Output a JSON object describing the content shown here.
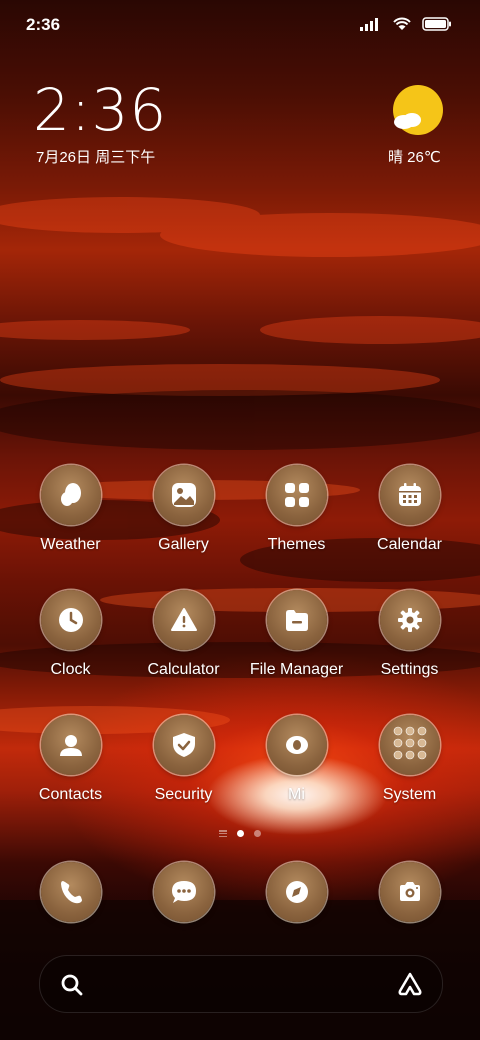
{
  "status_bar": {
    "time": "2:36",
    "signal_icon": "signal-bars-icon",
    "wifi_icon": "wifi-icon",
    "battery_icon": "battery-full-icon"
  },
  "clock_widget": {
    "time": "2:36",
    "date": "7月26日 周三下午"
  },
  "weather_widget": {
    "icon": "sun-cloud-icon",
    "summary": "晴 26℃",
    "sun_color": "#f5c518"
  },
  "apps": [
    {
      "label": "Weather",
      "icon": "weather-icon"
    },
    {
      "label": "Gallery",
      "icon": "gallery-icon"
    },
    {
      "label": "Themes",
      "icon": "themes-icon"
    },
    {
      "label": "Calendar",
      "icon": "calendar-icon"
    },
    {
      "label": "Clock",
      "icon": "clock-icon"
    },
    {
      "label": "Calculator",
      "icon": "calculator-icon"
    },
    {
      "label": "File Manager",
      "icon": "folder-icon"
    },
    {
      "label": "Settings",
      "icon": "gear-icon"
    },
    {
      "label": "Contacts",
      "icon": "contact-icon"
    },
    {
      "label": "Security",
      "icon": "shield-icon"
    },
    {
      "label": "Mi",
      "icon": "mi-icon"
    },
    {
      "label": "System",
      "icon": "folder-grid-icon"
    }
  ],
  "page_indicator": {
    "pages": 2,
    "current": 1
  },
  "dock": [
    {
      "name": "phone",
      "icon": "phone-icon"
    },
    {
      "name": "messages",
      "icon": "message-icon"
    },
    {
      "name": "browser",
      "icon": "compass-icon"
    },
    {
      "name": "camera",
      "icon": "camera-icon"
    }
  ],
  "search": {
    "icon": "search-icon",
    "assistant_icon": "assistant-icon"
  },
  "colors": {
    "icon_bg": "#8a633e",
    "accent_sun": "#f5c518"
  }
}
